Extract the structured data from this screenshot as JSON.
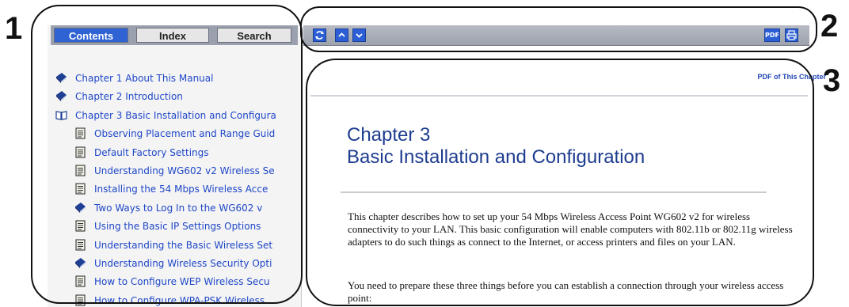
{
  "callouts": [
    "1",
    "2",
    "3"
  ],
  "nav": {
    "tabs": [
      {
        "label": "Contents",
        "active": true
      },
      {
        "label": "Index",
        "active": false
      },
      {
        "label": "Search",
        "active": false
      }
    ],
    "toc": [
      {
        "label": "Chapter 1 About This Manual",
        "icon": "book-closed-icon",
        "level": 0
      },
      {
        "label": "Chapter 2 Introduction",
        "icon": "book-closed-icon",
        "level": 0
      },
      {
        "label": "Chapter 3 Basic Installation and Configura",
        "icon": "book-open-icon",
        "level": 0
      },
      {
        "label": "Observing Placement and Range Guid",
        "icon": "page-icon",
        "level": 1
      },
      {
        "label": "Default Factory Settings",
        "icon": "page-icon",
        "level": 1
      },
      {
        "label": "Understanding WG602 v2 Wireless Se",
        "icon": "page-icon",
        "level": 1
      },
      {
        "label": "Installing the 54 Mbps Wireless Acce",
        "icon": "page-icon",
        "level": 1
      },
      {
        "label": "Two Ways to Log In to the WG602 v",
        "icon": "book-closed-icon",
        "level": 1
      },
      {
        "label": "Using the Basic IP Settings Options",
        "icon": "page-icon",
        "level": 1
      },
      {
        "label": "Understanding the Basic Wireless Set",
        "icon": "page-icon",
        "level": 1
      },
      {
        "label": "Understanding Wireless Security Opti",
        "icon": "book-closed-icon",
        "level": 1
      },
      {
        "label": "How to Configure WEP Wireless Secu",
        "icon": "page-icon",
        "level": 1
      },
      {
        "label": "How to Configure WPA-PSK Wireless",
        "icon": "page-icon",
        "level": 1
      }
    ]
  },
  "toolbar": {
    "sync_icon": "sync-icon",
    "prev_icon": "up-arrow-icon",
    "next_icon": "down-arrow-icon",
    "pdf_label": "PDF",
    "print_icon": "print-icon"
  },
  "content": {
    "pdf_link": "PDF of This Chapter",
    "chapter_number": "Chapter 3",
    "chapter_title": "Basic Installation and Configuration",
    "paragraph1": "This chapter describes how to set up your 54 Mbps Wireless Access Point WG602 v2 for wireless connectivity to your LAN. This basic configuration will enable computers with 802.11b or 802.11g wireless adapters to do such things as connect to the Internet, or access printers and files on your LAN.",
    "paragraph2": "You need to prepare these three things before you can establish a connection through your wireless access point:"
  },
  "colors": {
    "link": "#1f47c8",
    "tab_active": "#2f62d2",
    "heading": "#1e3d8f"
  }
}
